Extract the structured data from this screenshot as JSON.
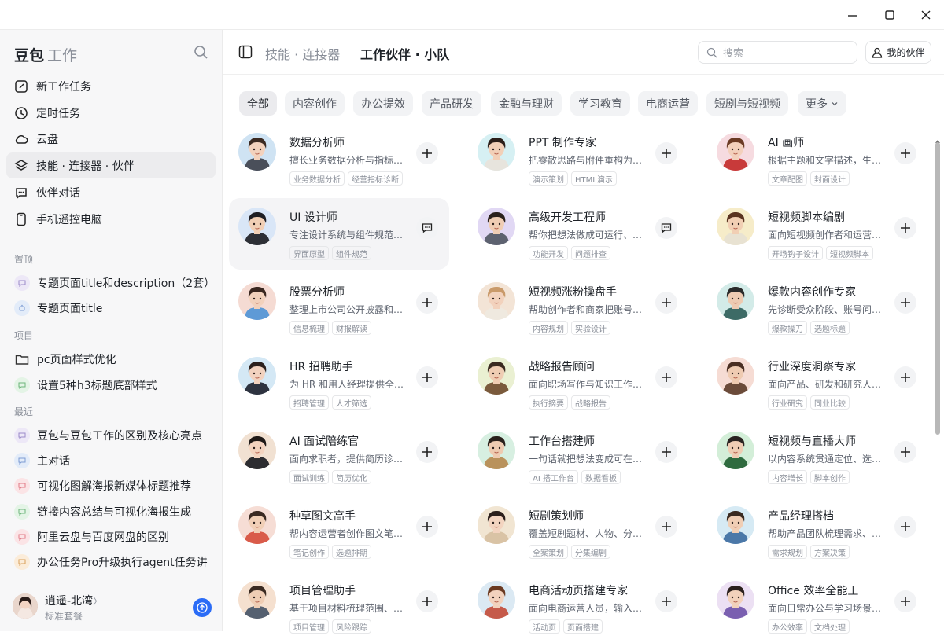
{
  "window": {
    "controls": [
      "minimize",
      "maximize",
      "close"
    ]
  },
  "sidebar": {
    "brand": "豆包",
    "brand_sub": "工作",
    "nav": [
      {
        "label": "新工作任务",
        "icon": "edit-icon"
      },
      {
        "label": "定时任务",
        "icon": "clock-icon"
      },
      {
        "label": "云盘",
        "icon": "cloud-icon"
      },
      {
        "label": "技能 · 连接器 · 伙伴",
        "icon": "layers-icon",
        "active": true
      },
      {
        "label": "伙伴对话",
        "icon": "chat-icon"
      },
      {
        "label": "手机遥控电脑",
        "icon": "phone-icon"
      }
    ],
    "pinned_title": "置顶",
    "pinned": [
      {
        "label": "专题页面title和description（2套）"
      },
      {
        "label": "专题页面title"
      }
    ],
    "projects_title": "项目",
    "projects": [
      {
        "label": "pc页面样式优化",
        "icon": "folder-icon"
      },
      {
        "label": "设置5种h3标题底部样式"
      }
    ],
    "recent_title": "最近",
    "recent": [
      {
        "label": "豆包与豆包工作的区别及核心亮点"
      },
      {
        "label": "主对话"
      },
      {
        "label": "可视化图解海报新媒体标题推荐"
      },
      {
        "label": "链接内容总结与可视化海报生成"
      },
      {
        "label": "阿里云盘与百度网盘的区别"
      },
      {
        "label": "办公任务Pro升级执行agent任务讲"
      }
    ],
    "user": {
      "name": "逍遥-北湾",
      "name_suffix": "〉",
      "plan": "标准套餐"
    }
  },
  "topbar": {
    "tab_skills": "技能 · 连接器",
    "tab_partners": "工作伙伴 · 小队",
    "search_placeholder": "搜索",
    "my_partner_label": "我的伙伴"
  },
  "categories": [
    {
      "label": "全部",
      "active": true
    },
    {
      "label": "内容创作"
    },
    {
      "label": "办公提效"
    },
    {
      "label": "产品研发"
    },
    {
      "label": "金融与理财"
    },
    {
      "label": "学习教育"
    },
    {
      "label": "电商运营"
    },
    {
      "label": "短剧与短视频"
    },
    {
      "label": "更多"
    }
  ],
  "partners": [
    {
      "name": "数据分析师",
      "desc": "擅长业务数据分析与指标…",
      "tags": [
        "业务数据分析",
        "经营指标诊断"
      ],
      "action": "add",
      "bg": "#cfe3f3",
      "skin": "#f3d2bd",
      "hair": "#3b2a22",
      "shirt": "#4a4f5a"
    },
    {
      "name": "PPT 制作专家",
      "desc": "把零散思路与附件重构为…",
      "tags": [
        "演示策划",
        "HTML演示"
      ],
      "action": "add",
      "bg": "#d6f0f3",
      "skin": "#f2d0b8",
      "hair": "#2b1f1a",
      "shirt": "#e7e4dd"
    },
    {
      "name": "AI 画师",
      "desc": "根据主题和文字描述，生…",
      "tags": [
        "文章配图",
        "封面设计"
      ],
      "action": "add",
      "bg": "#f6dbe0",
      "skin": "#f3d0bc",
      "hair": "#6b3a24",
      "shirt": "#c83a3a"
    },
    {
      "name": "UI 设计师",
      "desc": "专注设计系统与组件规范…",
      "tags": [
        "界面原型",
        "组件规范"
      ],
      "action": "chat",
      "bg": "#d9e6f7",
      "skin": "#f1cfb5",
      "hair": "#1e1e24",
      "shirt": "#2d2f36",
      "hover": true
    },
    {
      "name": "高级开发工程师",
      "desc": "帮你把想法做成可运行、…",
      "tags": [
        "功能开发",
        "问题排查"
      ],
      "action": "chat",
      "bg": "#e1d8f4",
      "skin": "#efcdb4",
      "hair": "#2a211d",
      "shirt": "#5d6270"
    },
    {
      "name": "短视频脚本编剧",
      "desc": "面向短视频创作者和运营…",
      "tags": [
        "开场钩子设计",
        "短视频脚本"
      ],
      "action": "add",
      "bg": "#f6ecc9",
      "skin": "#f1cfb4",
      "hair": "#5a3320",
      "shirt": "#e8e2d2"
    },
    {
      "name": "股票分析师",
      "desc": "整理上市公司公开披露和…",
      "tags": [
        "信息梳理",
        "财报解读"
      ],
      "action": "add",
      "bg": "#f5dbd3",
      "skin": "#f2d1bc",
      "hair": "#3a2720",
      "shirt": "#5e9ad6"
    },
    {
      "name": "短视频涨粉操盘手",
      "desc": "帮助创作者和商家把账号…",
      "tags": [
        "内容规划",
        "实验设计"
      ],
      "action": "add",
      "bg": "#f3e4d6",
      "skin": "#f2d2bd",
      "hair": "#c99a6a",
      "shirt": "#efe9df"
    },
    {
      "name": "爆款内容创作专家",
      "desc": "先诊断受众阶段、账号问…",
      "tags": [
        "爆款操刀",
        "选题标题"
      ],
      "action": "add",
      "bg": "#d3ebe8",
      "skin": "#eecbb2",
      "hair": "#2a2a2a",
      "shirt": "#3d6b66"
    },
    {
      "name": "HR 招聘助手",
      "desc": "为 HR 和用人经理提供全…",
      "tags": [
        "招聘管理",
        "人才筛选"
      ],
      "action": "add",
      "bg": "#d4e8f5",
      "skin": "#f2d2bf",
      "hair": "#2b201d",
      "shirt": "#2e3340"
    },
    {
      "name": "战略报告顾问",
      "desc": "面向职场写作与知识工作…",
      "tags": [
        "执行摘要",
        "战略报告"
      ],
      "action": "add",
      "bg": "#eaf0d2",
      "skin": "#efcdb3",
      "hair": "#3a2a20",
      "shirt": "#7a5a3c"
    },
    {
      "name": "行业深度洞察专家",
      "desc": "面向产品、研发和研究人…",
      "tags": [
        "行业研究",
        "同业比较"
      ],
      "action": "add",
      "bg": "#f6dcd4",
      "skin": "#efcbb2",
      "hair": "#4a2e22",
      "shirt": "#6b4b3a"
    },
    {
      "name": "AI 面试陪练官",
      "desc": "面向求职者，提供简历诊…",
      "tags": [
        "面试训练",
        "简历优化"
      ],
      "action": "add",
      "bg": "#f1e1d2",
      "skin": "#f3d3bf",
      "hair": "#1f1a18",
      "shirt": "#2c2c30"
    },
    {
      "name": "工作台搭建师",
      "desc": "一句话就把想法变成可在…",
      "tags": [
        "AI 搭工作台",
        "数据看板"
      ],
      "action": "add",
      "bg": "#d7efe1",
      "skin": "#eecbb1",
      "hair": "#2a211c",
      "shirt": "#b9925c"
    },
    {
      "name": "短视频与直播大师",
      "desc": "以内容系统贯通定位、选…",
      "tags": [
        "内容增长",
        "脚本创作"
      ],
      "action": "add",
      "bg": "#d3eed8",
      "skin": "#efcdb4",
      "hair": "#2a2321",
      "shirt": "#2f6b3f"
    },
    {
      "name": "种草图文高手",
      "desc": "帮内容运营者创作图文笔…",
      "tags": [
        "笔记创作",
        "选题排期"
      ],
      "action": "add",
      "bg": "#f6ddd5",
      "skin": "#f1cfb6",
      "hair": "#3b2a22",
      "shirt": "#d95b4a"
    },
    {
      "name": "短剧策划师",
      "desc": "覆盖短剧题材、人物、分…",
      "tags": [
        "全案策划",
        "分集编剧"
      ],
      "action": "add",
      "bg": "#f1e5d2",
      "skin": "#f3d4c0",
      "hair": "#2b1f1b",
      "shirt": "#d9c3a5"
    },
    {
      "name": "产品经理搭档",
      "desc": "帮助产品团队梳理需求、…",
      "tags": [
        "需求规划",
        "方案决策"
      ],
      "action": "add",
      "bg": "#d6eaf4",
      "skin": "#f0ceb5",
      "hair": "#3a2b22",
      "shirt": "#4b78a8"
    },
    {
      "name": "项目管理助手",
      "desc": "基于项目材料梳理范围、…",
      "tags": [
        "项目管理",
        "风险跟踪"
      ],
      "action": "add",
      "bg": "#f5e0cf",
      "skin": "#efcdb4",
      "hair": "#3a2a21",
      "shirt": "#556070"
    },
    {
      "name": "电商活动页搭建专家",
      "desc": "面向电商运营人员，输入…",
      "tags": [
        "活动页",
        "页面搭建"
      ],
      "action": "add",
      "bg": "#dbe9f3",
      "skin": "#f2d2bd",
      "hair": "#6a3a22",
      "shirt": "#c55a4a"
    },
    {
      "name": "Office 效率全能王",
      "desc": "面向日常办公与学习场景…",
      "tags": [
        "办公效率",
        "文档处理"
      ],
      "action": "add",
      "bg": "#ece0f3",
      "skin": "#f2d1bb",
      "hair": "#2a1f1c",
      "shirt": "#7a5fb0"
    }
  ]
}
